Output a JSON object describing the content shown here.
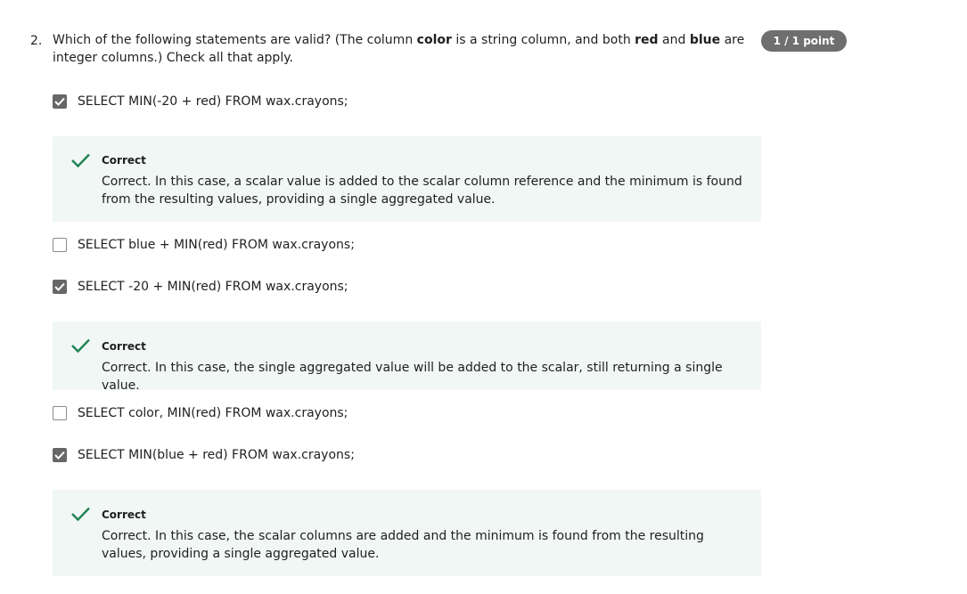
{
  "question": {
    "number": "2.",
    "text_parts": {
      "p1": "Which of the following statements are valid? (The column ",
      "b1": "color",
      "p2": " is a string column, and both ",
      "b2": "red",
      "p3": " and ",
      "b3": "blue",
      "p4": " are integer columns.) Check all that apply."
    },
    "score": "1 / 1 point"
  },
  "options": [
    {
      "label": "SELECT MIN(-20 + red) FROM wax.crayons;",
      "checked": true
    },
    {
      "label": "SELECT blue + MIN(red) FROM wax.crayons;",
      "checked": false
    },
    {
      "label": "SELECT -20 + MIN(red) FROM wax.crayons;",
      "checked": true
    },
    {
      "label": "SELECT color, MIN(red) FROM wax.crayons;",
      "checked": false
    },
    {
      "label": "SELECT MIN(blue + red) FROM wax.crayons;",
      "checked": true
    }
  ],
  "feedback": [
    {
      "title": "Correct",
      "text": "Correct. In this case, a scalar value is added to the scalar column reference and the minimum is found from the resulting values, providing a single aggregated value."
    },
    {
      "title": "Correct",
      "text": "Correct. In this case, the single aggregated value will be added to the scalar, still returning a single value."
    },
    {
      "title": "Correct",
      "text": "Correct. In this case, the scalar columns are added and the minimum is found from the resulting values, providing a single aggregated value."
    }
  ],
  "colors": {
    "checkbox_checked": "#676767",
    "feedback_bg": "#f1f7f5",
    "correct_check": "#1f8354",
    "badge_bg": "#6f6f6f"
  },
  "icons": {
    "checkmark": "check-icon",
    "checkbox_tick": "checkbox-tick-icon"
  }
}
